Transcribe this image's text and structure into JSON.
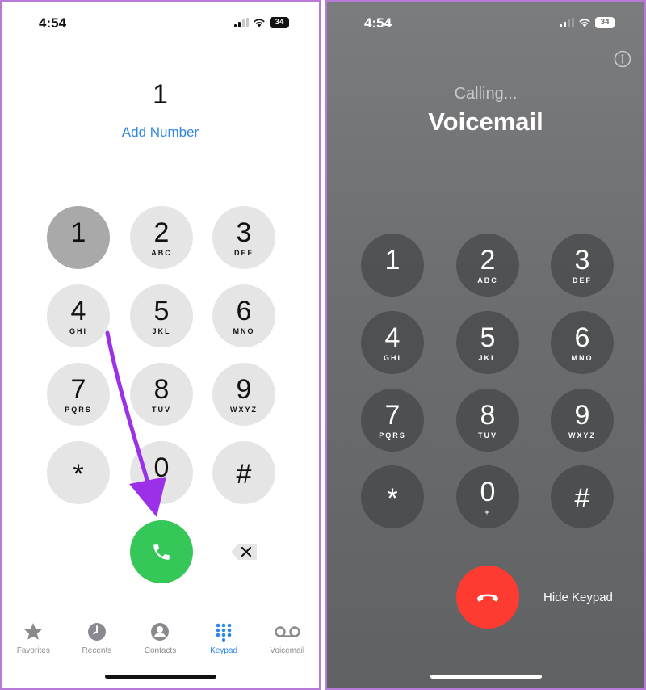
{
  "left": {
    "status": {
      "time": "4:54",
      "battery": "34"
    },
    "dialed_number": "1",
    "add_number_label": "Add Number",
    "keys": [
      {
        "digit": "1",
        "letters": ""
      },
      {
        "digit": "2",
        "letters": "ABC"
      },
      {
        "digit": "3",
        "letters": "DEF"
      },
      {
        "digit": "4",
        "letters": "GHI"
      },
      {
        "digit": "5",
        "letters": "JKL"
      },
      {
        "digit": "6",
        "letters": "MNO"
      },
      {
        "digit": "7",
        "letters": "PQRS"
      },
      {
        "digit": "8",
        "letters": "TUV"
      },
      {
        "digit": "9",
        "letters": "WXYZ"
      },
      {
        "digit": "*",
        "letters": ""
      },
      {
        "digit": "0",
        "letters": "+"
      },
      {
        "digit": "#",
        "letters": ""
      }
    ],
    "pressed_key": "1",
    "tabs": [
      {
        "label": "Favorites",
        "icon": "star-icon"
      },
      {
        "label": "Recents",
        "icon": "clock-icon"
      },
      {
        "label": "Contacts",
        "icon": "person-icon"
      },
      {
        "label": "Keypad",
        "icon": "keypad-icon"
      },
      {
        "label": "Voicemail",
        "icon": "voicemail-icon"
      }
    ],
    "active_tab": "Keypad",
    "annotation": {
      "icon": "arrow-icon",
      "color": "#9b30e8"
    }
  },
  "right": {
    "status": {
      "time": "4:54",
      "battery": "34"
    },
    "calling_label": "Calling...",
    "callee": "Voicemail",
    "keys": [
      {
        "digit": "1",
        "letters": ""
      },
      {
        "digit": "2",
        "letters": "ABC"
      },
      {
        "digit": "3",
        "letters": "DEF"
      },
      {
        "digit": "4",
        "letters": "GHI"
      },
      {
        "digit": "5",
        "letters": "JKL"
      },
      {
        "digit": "6",
        "letters": "MNO"
      },
      {
        "digit": "7",
        "letters": "PQRS"
      },
      {
        "digit": "8",
        "letters": "TUV"
      },
      {
        "digit": "9",
        "letters": "WXYZ"
      },
      {
        "digit": "*",
        "letters": ""
      },
      {
        "digit": "0",
        "letters": "+"
      },
      {
        "digit": "#",
        "letters": ""
      }
    ],
    "hide_keypad_label": "Hide Keypad"
  },
  "colors": {
    "call_green": "#36c759",
    "end_red": "#fe3b30",
    "accent_blue": "#2f86e6",
    "frame_purple": "#b77ad9"
  }
}
